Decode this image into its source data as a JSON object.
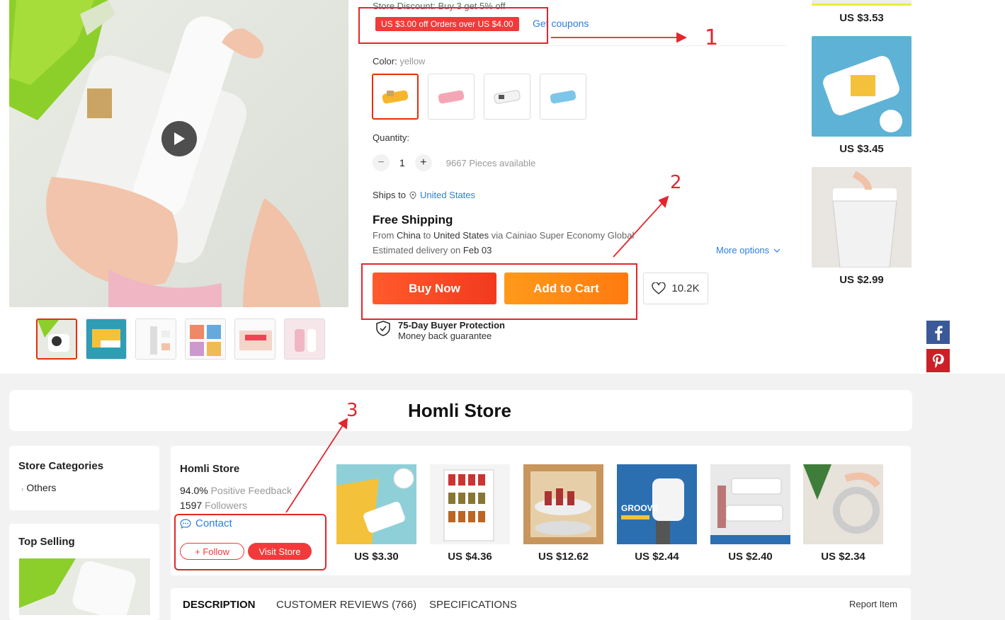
{
  "product": {
    "store_discount": "Store Discount: Buy 3 get 5% off",
    "coupon_tag": "US $3.00 off Orders over US $4.00",
    "get_coupons": "Get coupons",
    "color_label": "Color:",
    "color_value": "yellow",
    "quantity_label": "Quantity:",
    "quantity_value": "1",
    "pieces_available": "9667 Pieces available",
    "ships_to_label": "Ships to",
    "ships_to_value": "United States",
    "free_shipping": "Free Shipping",
    "from_label": "From",
    "from_country": "China",
    "to_label": "to",
    "to_country": "United States",
    "via_label": "via",
    "carrier": "Cainiao Super Economy Global",
    "est_label": "Estimated delivery on",
    "est_date": "Feb 03",
    "more_options": "More options",
    "buy_now": "Buy Now",
    "add_to_cart": "Add to Cart",
    "wishlist_count": "10.2K",
    "protection_title": "75-Day Buyer Protection",
    "protection_sub": "Money back guarantee"
  },
  "recommendations": [
    {
      "price": "US $3.53"
    },
    {
      "price": "US $3.45"
    },
    {
      "price": "US $2.99"
    }
  ],
  "annotations": [
    "1",
    "2",
    "3"
  ],
  "social": [
    "facebook-icon",
    "pinterest-icon",
    "vk-icon",
    "twitter-icon",
    "edit-icon",
    "close-icon"
  ],
  "store": {
    "banner_title": "Homli Store",
    "categories_title": "Store Categories",
    "categories": [
      "Others"
    ],
    "top_selling_title": "Top Selling",
    "name": "Homli Store",
    "feedback_value": "94.0%",
    "feedback_label": "Positive Feedback",
    "followers_value": "1597",
    "followers_label": "Followers",
    "contact": "Contact",
    "follow": "+ Follow",
    "visit_store": "Visit Store",
    "products": [
      {
        "price": "US $3.30"
      },
      {
        "price": "US $4.36"
      },
      {
        "price": "US $12.62"
      },
      {
        "price": "US $2.44",
        "image_text": "GROOVE"
      },
      {
        "price": "US $2.40"
      },
      {
        "price": "US $2.34"
      }
    ]
  },
  "tabs": {
    "description": "DESCRIPTION",
    "reviews": "CUSTOMER REVIEWS (766)",
    "specifications": "SPECIFICATIONS",
    "report": "Report Item"
  }
}
